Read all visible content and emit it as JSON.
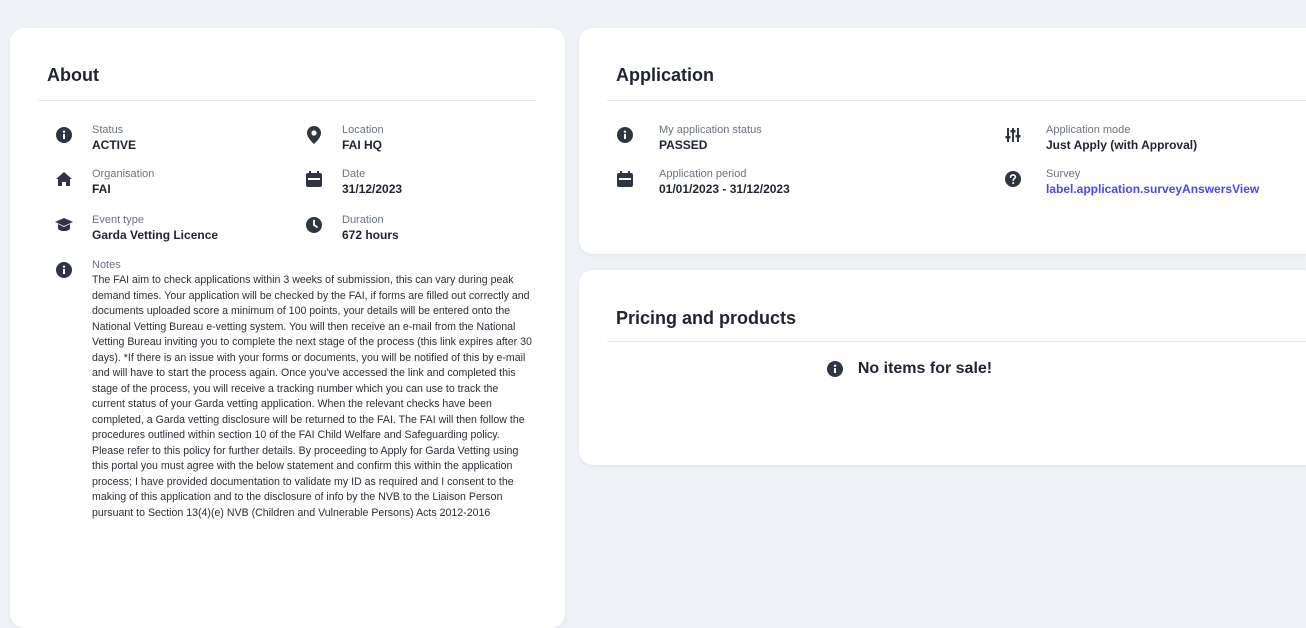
{
  "about": {
    "title": "About",
    "status": {
      "label": "Status",
      "value": "ACTIVE",
      "icon": "info-icon"
    },
    "location": {
      "label": "Location",
      "value": "FAI HQ",
      "icon": "location-pin-icon"
    },
    "organisation": {
      "label": "Organisation",
      "value": "FAI",
      "icon": "home-icon"
    },
    "date": {
      "label": "Date",
      "value": "31/12/2023",
      "icon": "calendar-icon"
    },
    "event_type": {
      "label": "Event type",
      "value": "Garda Vetting Licence",
      "icon": "graduation-cap-icon"
    },
    "duration": {
      "label": "Duration",
      "value": "672 hours",
      "icon": "clock-icon"
    },
    "notes": {
      "label": "Notes",
      "icon": "info-icon",
      "text": "The FAI aim to check applications within 3 weeks of submission, this can vary during peak demand times. Your application will be checked by the FAI, if forms are filled out correctly and documents uploaded score a minimum of 100 points, your details will be entered onto the National Vetting Bureau e-vetting system. You will then receive an e-mail from the National Vetting Bureau inviting you to complete the next stage of the process (this link expires after 30 days). *If there is an issue with your forms or documents, you will be notified of this by e-mail and will have to start the process again. Once you've accessed the link and completed this stage of the process, you will receive a tracking number which you can use to track the current status of your Garda vetting application. When the relevant checks have been completed, a Garda vetting disclosure will be returned to the FAI. The FAI will then follow the procedures outlined within section 10 of the FAI Child Welfare and Safeguarding policy. Please refer to this policy for further details. By proceeding to Apply for Garda Vetting using this portal you must agree with the below statement and confirm this within the application process; I have provided documentation to validate my ID as required and I consent to the making of this application and to the disclosure of info by the NVB to the Liaison Person pursuant to Section 13(4)(e) NVB (Children and Vulnerable Persons) Acts 2012-2016"
    }
  },
  "application": {
    "title": "Application",
    "status": {
      "label": "My application status",
      "value": "PASSED",
      "icon": "info-icon"
    },
    "mode": {
      "label": "Application mode",
      "value": "Just Apply (with Approval)",
      "icon": "sliders-icon"
    },
    "period": {
      "label": "Application period",
      "value": "01/01/2023 - 31/12/2023",
      "icon": "calendar-icon"
    },
    "survey": {
      "label": "Survey",
      "value": "label.application.surveyAnswersView",
      "icon": "question-icon"
    }
  },
  "pricing": {
    "title": "Pricing and products",
    "empty_message": "No items for sale!",
    "icon": "info-icon"
  },
  "colors": {
    "accent_link": "#4f46e5",
    "icon": "#2f3542",
    "background": "#eef1f5"
  }
}
